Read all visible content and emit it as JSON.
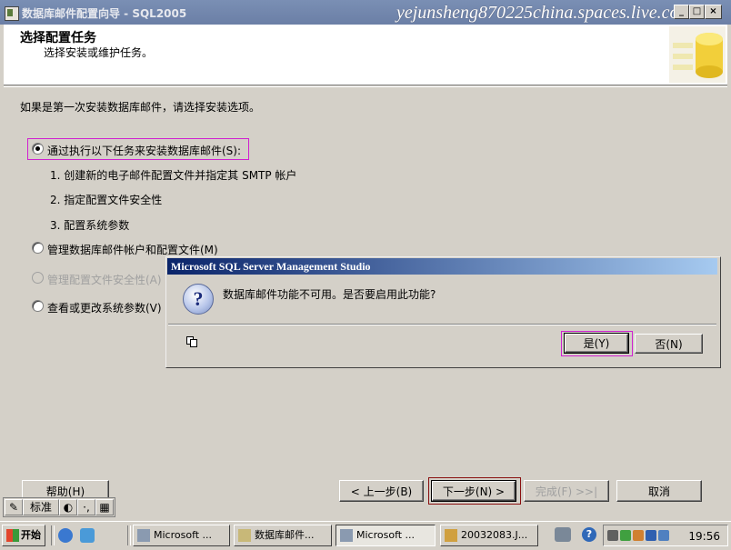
{
  "window": {
    "title": "数据库邮件配置向导 - SQL2005",
    "watermark": "yejunsheng870225china.spaces.live.com",
    "controls": [
      "_",
      "□",
      "×"
    ]
  },
  "header": {
    "title": "选择配置任务",
    "subtitle": "选择安装或维护任务。"
  },
  "main": {
    "intro": "如果是第一次安装数据库邮件，请选择安装选项。",
    "options": [
      {
        "label": "通过执行以下任务来安装数据库邮件(S):",
        "checked": true,
        "enabled": true
      },
      {
        "label": "管理数据库邮件帐户和配置文件(M)",
        "checked": false,
        "enabled": true
      },
      {
        "label": "管理配置文件安全性(A)",
        "checked": false,
        "enabled": false
      },
      {
        "label": "查看或更改系统参数(V)",
        "checked": false,
        "enabled": true
      }
    ],
    "steps": [
      "1. 创建新的电子邮件配置文件并指定其 SMTP 帐户",
      "2. 指定配置文件安全性",
      "3. 配置系统参数"
    ]
  },
  "dialog": {
    "title": "Microsoft SQL Server Management Studio",
    "icon": "question-icon",
    "message": "数据库邮件功能不可用。是否要启用此功能?",
    "yes_label": "是(Y)",
    "no_label": "否(N)"
  },
  "footer": {
    "help_label": "帮助(H)",
    "back_label": "< 上一步(B)",
    "next_label": "下一步(N) >",
    "finish_label": "完成(F) >>|",
    "cancel_label": "取消"
  },
  "ime": {
    "mode": "标准"
  },
  "taskbar": {
    "start_label": "开始",
    "tasks": [
      {
        "label": "Microsoft ...",
        "active": false
      },
      {
        "label": "数据库邮件...",
        "active": false
      },
      {
        "label": "Microsoft ...",
        "active": true
      },
      {
        "label": "20032083.J...",
        "active": false
      }
    ],
    "clock": "19:56"
  },
  "colors": {
    "highlight": "#d020d0",
    "next_highlight": "#8a1010",
    "dialog_title": "#0a246a"
  }
}
